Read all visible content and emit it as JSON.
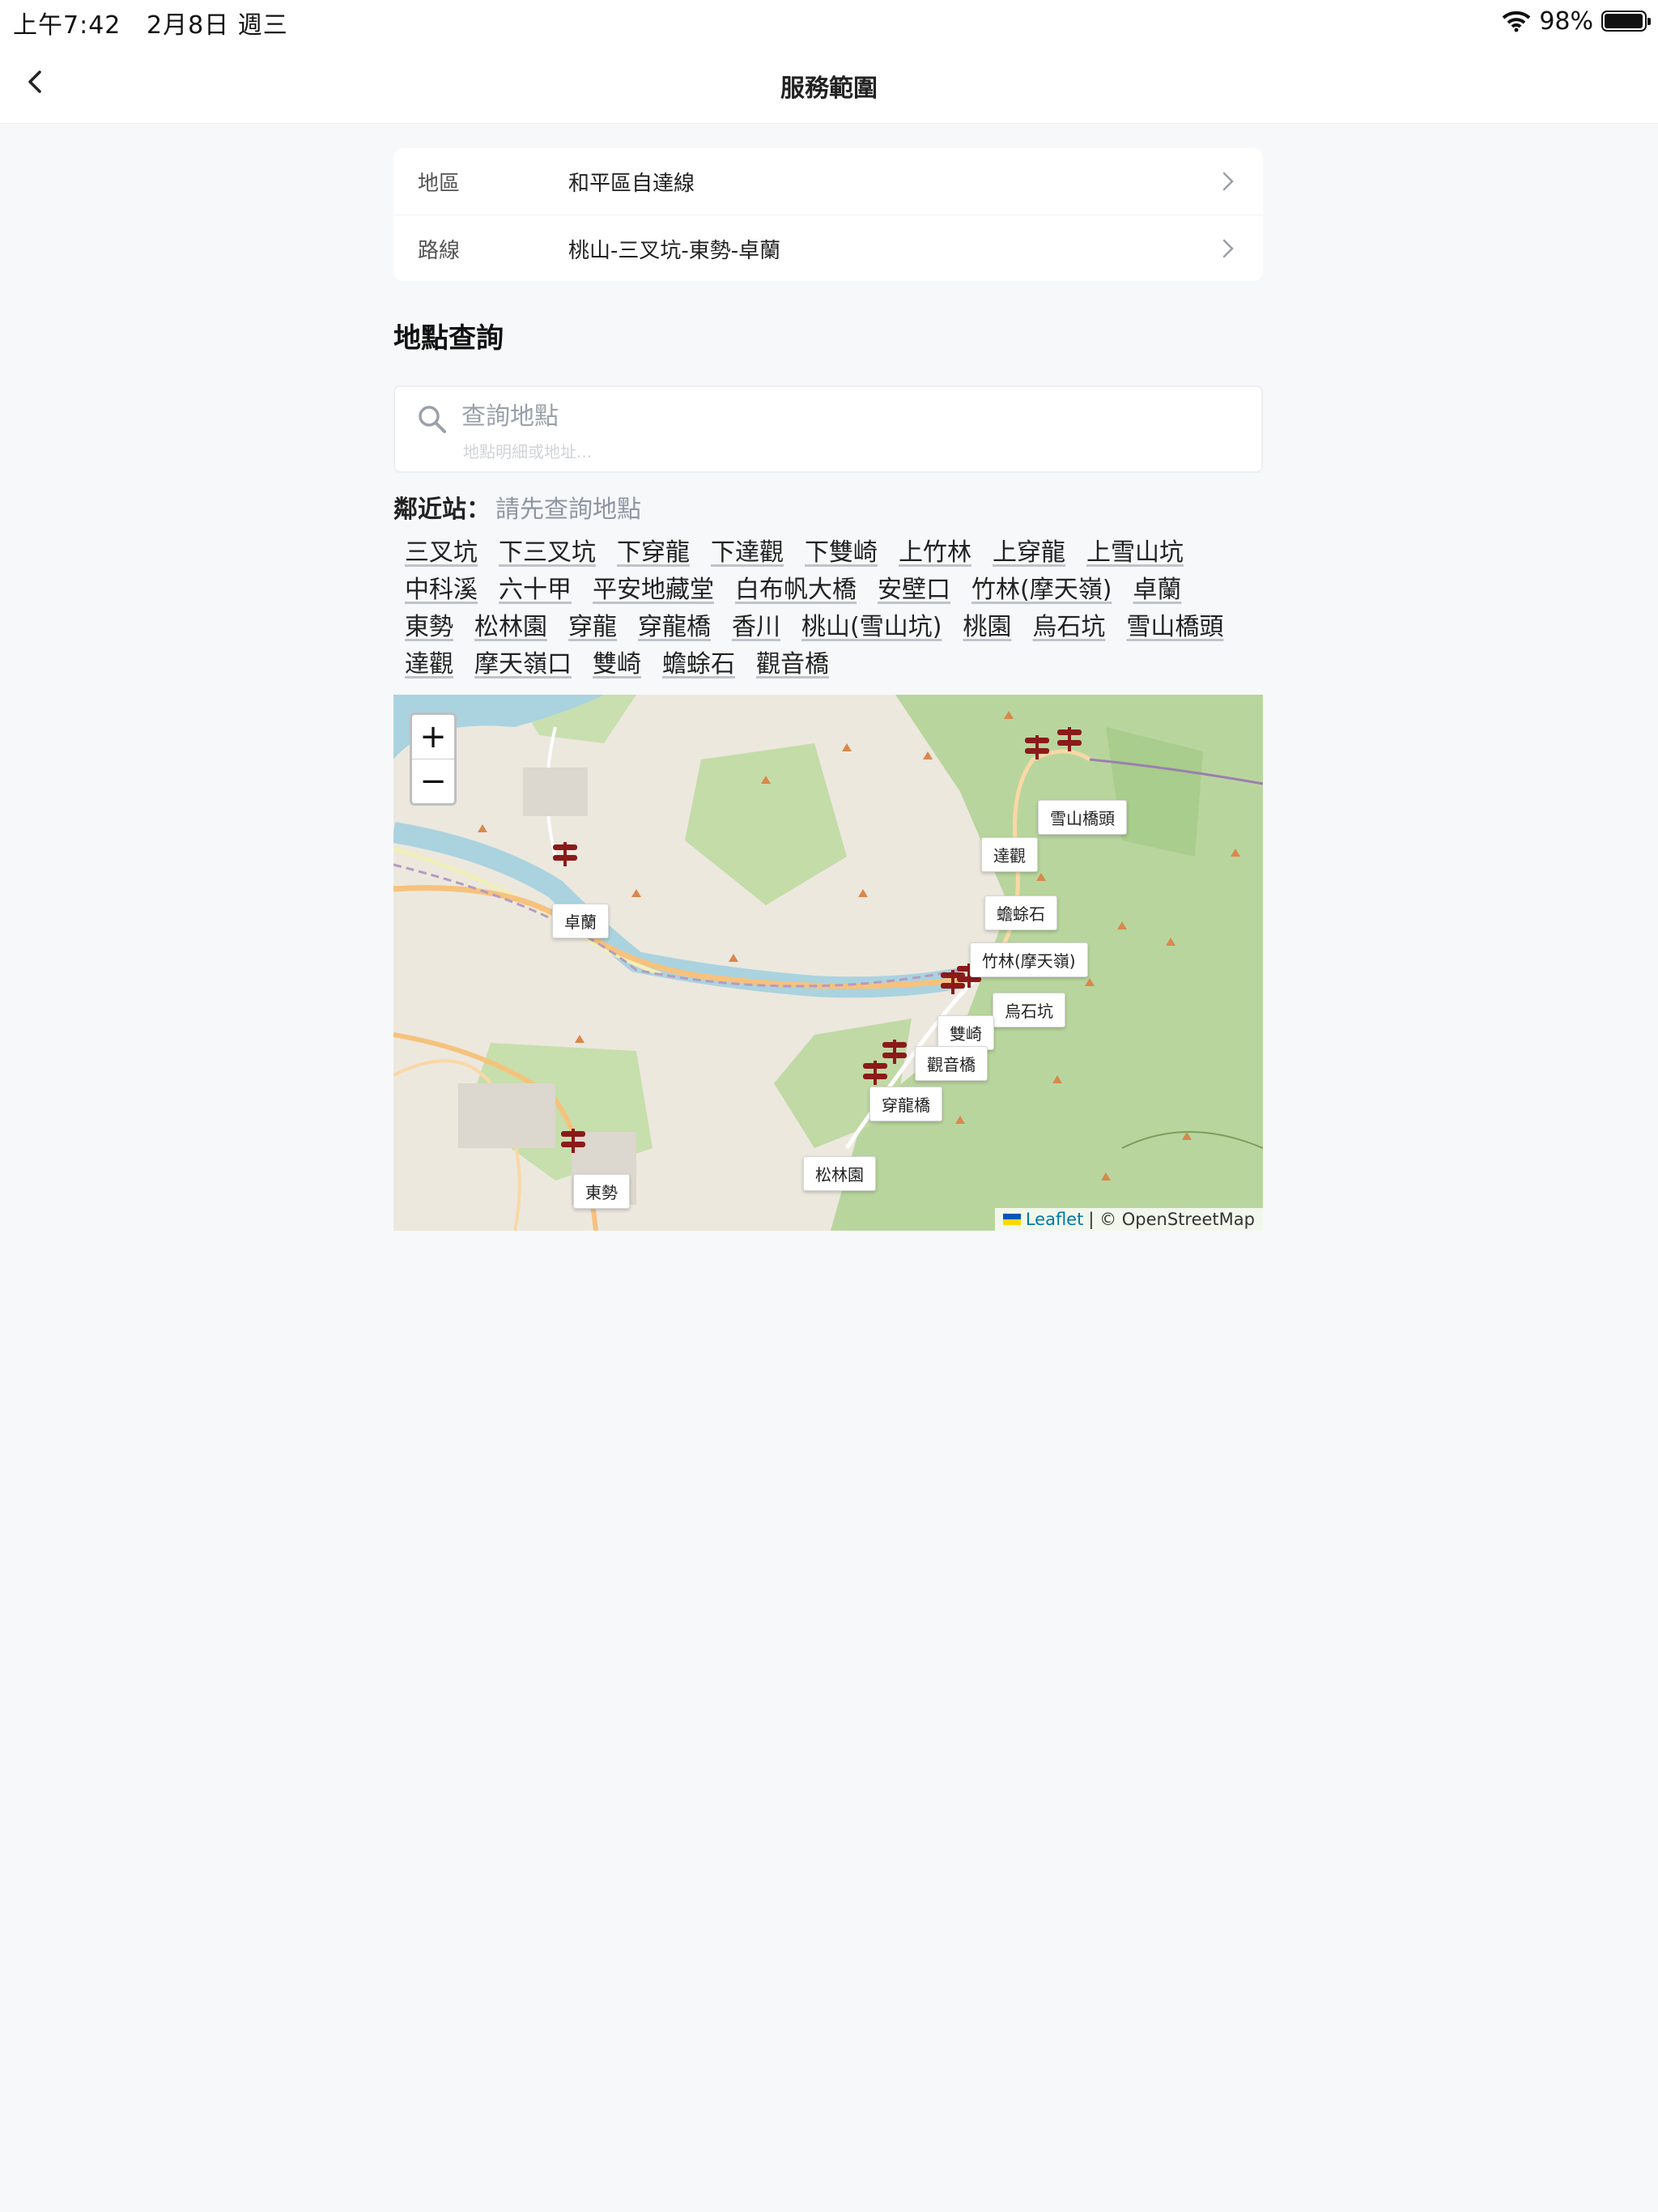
{
  "status_bar": {
    "time": "上午7:42",
    "date": "2月8日 週三",
    "battery": "98%",
    "battery_level": 0.98
  },
  "nav": {
    "title": "服務範圍",
    "back_icon": "chevron-left-icon"
  },
  "selector": {
    "region": {
      "label": "地區",
      "value": "和平區自達線"
    },
    "route": {
      "label": "路線",
      "value": "桃山-三叉坑-東勢-卓蘭"
    }
  },
  "location_search": {
    "title": "地點查詢",
    "placeholder": "查詢地點",
    "hint": "地點明細或地址..."
  },
  "nearby": {
    "label": "鄰近站：",
    "value": "請先查詢地點"
  },
  "stations": [
    "三叉坑",
    "下三叉坑",
    "下穿龍",
    "下達觀",
    "下雙崎",
    "上竹林",
    "上穿龍",
    "上雪山坑",
    "中科溪",
    "六十甲",
    "平安地藏堂",
    "白布帆大橋",
    "安壁口",
    "竹林(摩天嶺)",
    "卓蘭",
    "東勢",
    "松林園",
    "穿龍",
    "穿龍橋",
    "香川",
    "桃山(雪山坑)",
    "桃園",
    "烏石坑",
    "雪山橋頭",
    "達觀",
    "摩天嶺口",
    "雙崎",
    "蟾蜍石",
    "觀音橋"
  ],
  "map": {
    "zoom_in": "+",
    "zoom_out": "−",
    "labels": {
      "zhuolan": "卓蘭",
      "xueshan": "雪山橋頭",
      "daguan": "達觀",
      "chanchu": "蟾蜍石",
      "zhulin": "竹林(摩天嶺)",
      "wushikeng": "烏石坑",
      "shuangqi": "雙崎",
      "guanyin": "觀音橋",
      "chuanlong": "穿龍橋",
      "songlin": "松林園",
      "dongshi": "東勢"
    },
    "attribution_leaflet": "Leaflet",
    "attribution_osm": "| © OpenStreetMap",
    "colors": {
      "marker": "#8b1a1a",
      "forest": "#b5d29a",
      "river": "#aad3df"
    }
  }
}
